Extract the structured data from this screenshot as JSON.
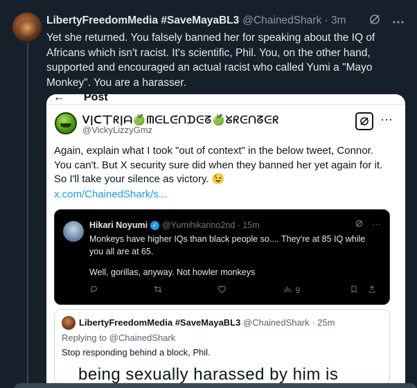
{
  "post": {
    "author_name": "LibertyFreedomMedia #SaveMayaBL3",
    "author_handle": "@ChainedShark",
    "time": "· 3m",
    "text": "Yet she returned. You falsely banned her for speaking about the IQ of Africans which isn't racist. It's scientific, Phil. You, on the other hand, supported and encouraged an actual racist who called Yumi a \"Mayo Monkey\". You are a harasser."
  },
  "screenshot": {
    "header_title": "Post",
    "quoted": {
      "name": "ᐯ|ᑕ丅ᖇ|ᗩ🍏ᗰᕮᒪᕮ́ᑎᗪᕮᘔ🍏ᘜᖇᕮᑎᘔᕮᖇ",
      "handle": "@VickyLizzyGmz",
      "text": "Again, explain what I took \"out of context\" in the below tweet, Connor. You can't. But X security sure did when they banned her yet again for it. So I'll take your silence as victory. 😉",
      "link": "x.com/ChainedShark/s..."
    },
    "embedded": {
      "name": "Hikari Noyumi",
      "handle": "@Yumihikarino2nd",
      "time": "· 15m",
      "text": "Monkeys have higher IQs than black people so.... They're at 85 IQ while you all are at 65.",
      "text2": "Well, gorillas, anyway. Not howler monkeys",
      "views": "9"
    },
    "reply": {
      "name": "LibertyFreedomMedia #SaveMayaBL3",
      "handle": "@ChainedShark",
      "time": "· 25m",
      "replying_to": "Replying to @ChainedShark",
      "text": "Stop responding behind a block, Phil.",
      "overlay_text": "being sexually harassed by him is"
    }
  },
  "icons": {
    "grok": "grok-icon",
    "more": "more-icon",
    "reply": "reply-icon",
    "retweet": "retweet-icon",
    "like": "like-icon",
    "views": "views-icon",
    "bookmark": "bookmark-icon",
    "share": "share-icon"
  },
  "colors": {
    "background": "#15202b",
    "accent": "#1d9bf0",
    "verified": "#1d9bf0"
  }
}
